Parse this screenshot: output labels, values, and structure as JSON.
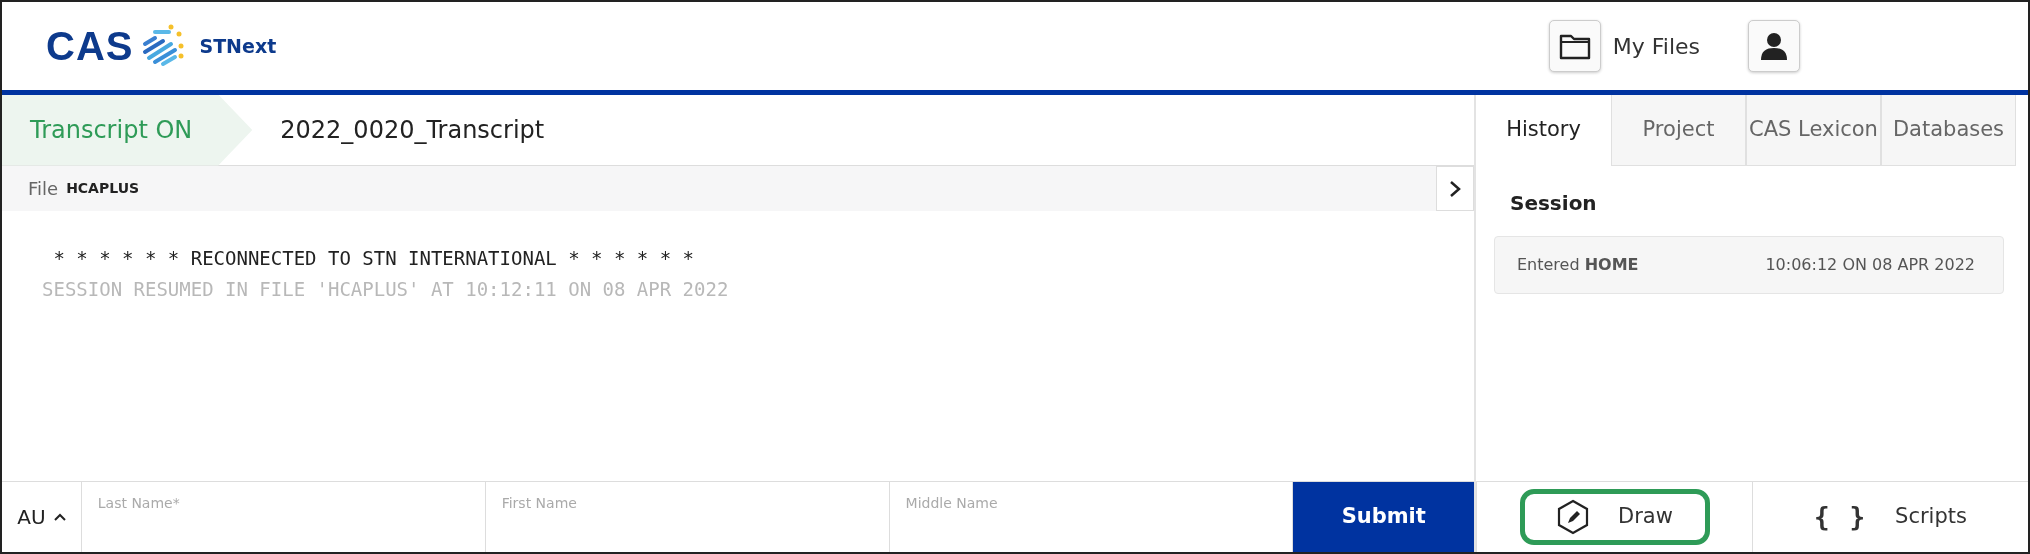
{
  "header": {
    "logo": "CAS",
    "product": "STNext",
    "my_files": "My Files"
  },
  "transcript": {
    "status": "Transcript ON",
    "name": "2022_0020_Transcript"
  },
  "file": {
    "label": "File",
    "value": "HCAPLUS"
  },
  "output_lines": [
    {
      "text": " * * * * * * RECONNECTED TO STN INTERNATIONAL * * * * * *",
      "faded": false
    },
    {
      "text": "SESSION RESUMED IN FILE 'HCAPLUS' AT 10:12:11 ON 08 APR 2022",
      "faded": true
    }
  ],
  "tabs": [
    {
      "label": "History",
      "selected": true
    },
    {
      "label": "Project",
      "selected": false
    },
    {
      "label": "CAS Lexicon",
      "selected": false
    },
    {
      "label": "Databases",
      "selected": false
    }
  ],
  "session": {
    "title": "Session",
    "entries": [
      {
        "action": "Entered **HOME**",
        "time": "10:06:12 ON 08 APR 2022"
      }
    ]
  },
  "query": {
    "field_code": "AU",
    "fields": [
      {
        "placeholder": "Last Name*"
      },
      {
        "placeholder": "First Name"
      },
      {
        "placeholder": "Middle Name"
      }
    ],
    "submit": "Submit"
  },
  "tools": [
    {
      "kind": "draw",
      "label": "Draw",
      "highlighted": true
    },
    {
      "kind": "scripts",
      "label": "Scripts",
      "icon_text": "{ }",
      "highlighted": false
    }
  ]
}
